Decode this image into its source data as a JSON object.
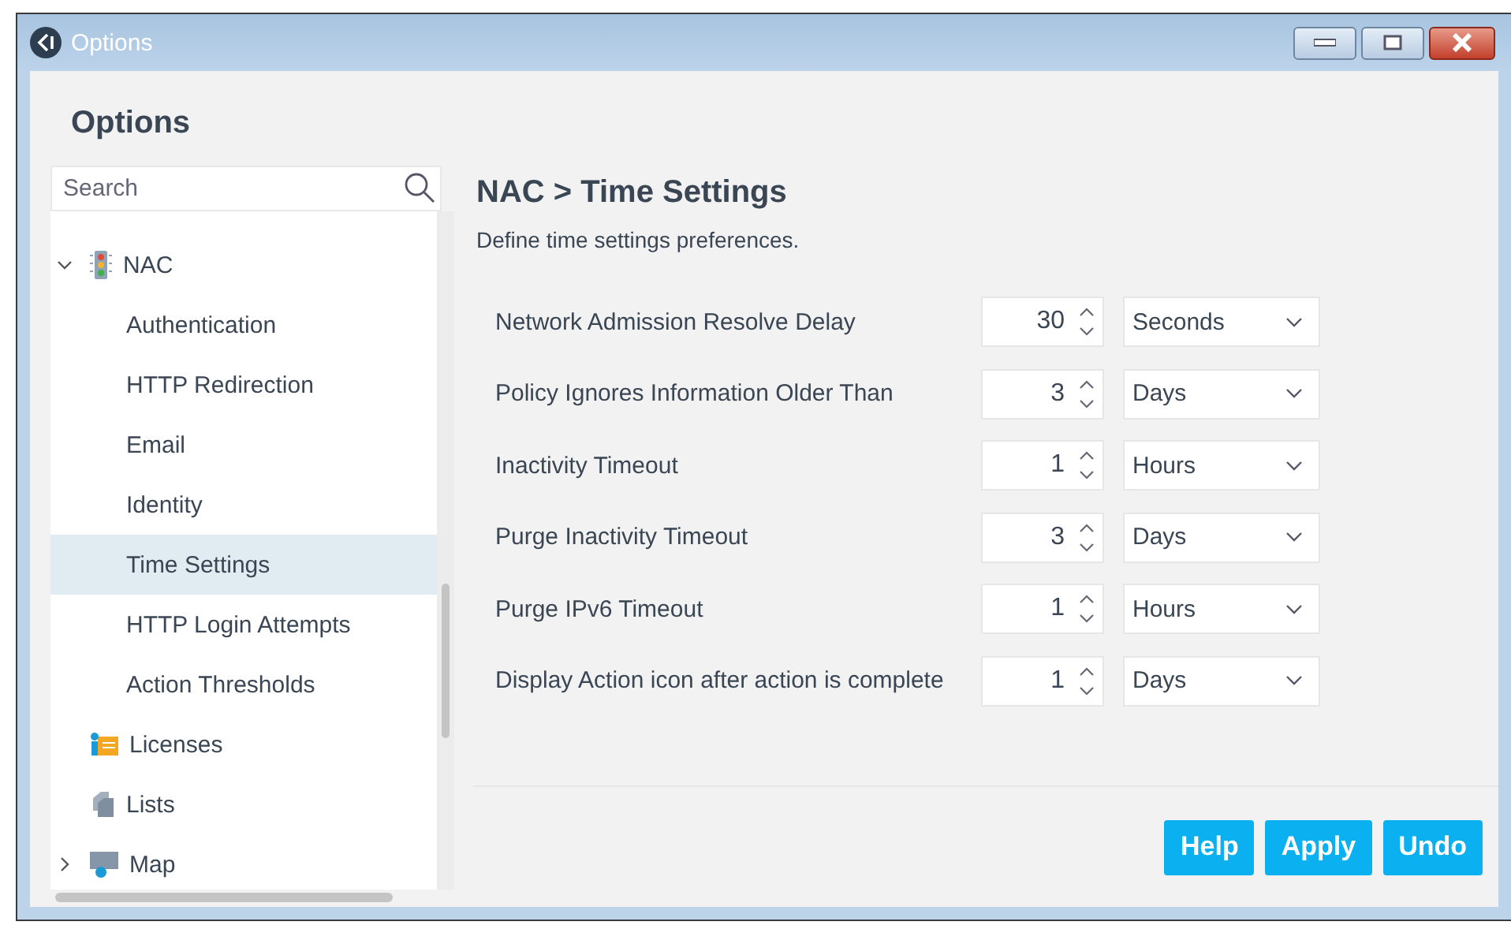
{
  "window": {
    "title": "Options"
  },
  "heading": "Options",
  "sidebar": {
    "search": {
      "placeholder": "Search"
    },
    "items": [
      {
        "label": "NAC",
        "kind": "traffic",
        "expanded": true,
        "selected": false,
        "children": [
          {
            "label": "Authentication",
            "selected": false
          },
          {
            "label": "HTTP Redirection",
            "selected": false
          },
          {
            "label": "Email",
            "selected": false
          },
          {
            "label": "Identity",
            "selected": false
          },
          {
            "label": "Time Settings",
            "selected": true
          },
          {
            "label": "HTTP Login Attempts",
            "selected": false
          },
          {
            "label": "Action Thresholds",
            "selected": false
          }
        ]
      },
      {
        "label": "Licenses",
        "kind": "licenses",
        "selected": false
      },
      {
        "label": "Lists",
        "kind": "lists",
        "selected": false
      },
      {
        "label": "Map",
        "kind": "map",
        "expanded": false,
        "selected": false
      }
    ]
  },
  "panel": {
    "title": "NAC > Time Settings",
    "description": "Define time settings preferences.",
    "settings": [
      {
        "label": "Network Admission Resolve Delay",
        "value": "30",
        "unit": "Seconds"
      },
      {
        "label": "Policy Ignores Information Older Than",
        "value": "3",
        "unit": "Days"
      },
      {
        "label": "Inactivity Timeout",
        "value": "1",
        "unit": "Hours"
      },
      {
        "label": "Purge Inactivity Timeout",
        "value": "3",
        "unit": "Days"
      },
      {
        "label": "Purge IPv6 Timeout",
        "value": "1",
        "unit": "Hours"
      },
      {
        "label": "Display Action icon after action is complete",
        "value": "1",
        "unit": "Days"
      }
    ]
  },
  "buttons": [
    "Help",
    "Apply",
    "Undo"
  ]
}
